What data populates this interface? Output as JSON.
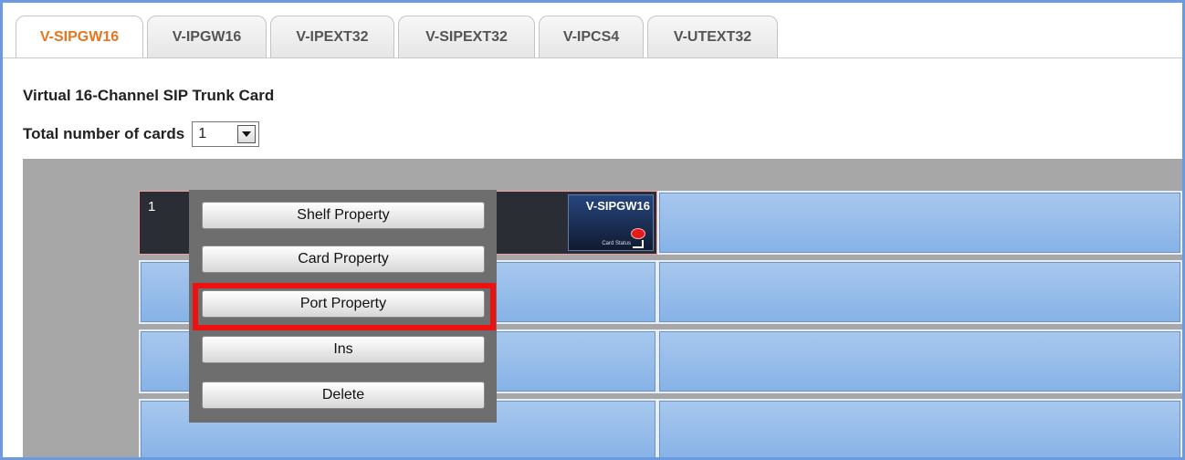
{
  "tabs": [
    {
      "label": "V-SIPGW16",
      "active": true
    },
    {
      "label": "V-IPGW16",
      "active": false
    },
    {
      "label": "V-IPEXT32",
      "active": false
    },
    {
      "label": "V-SIPEXT32",
      "active": false
    },
    {
      "label": "V-IPCS4",
      "active": false
    },
    {
      "label": "V-UTEXT32",
      "active": false
    }
  ],
  "page": {
    "title": "Virtual 16-Channel SIP Trunk Card",
    "total_cards_label": "Total number of cards",
    "total_cards_value": "1"
  },
  "card": {
    "slot_number": "1",
    "type_label": "V-SIPGW16",
    "status_label": "Card Status"
  },
  "context_menu": {
    "items": [
      "Shelf Property",
      "Card Property",
      "Port Property",
      "Ins",
      "Delete"
    ],
    "highlighted_item": "Port Property"
  },
  "colors": {
    "active_tab": "#e5761f",
    "frame_border": "#6a9be0",
    "slot_blue": "#93bbea",
    "highlight": "#ee1111",
    "card_bg": "#2a2d33",
    "status_led": "#e31b1b"
  }
}
